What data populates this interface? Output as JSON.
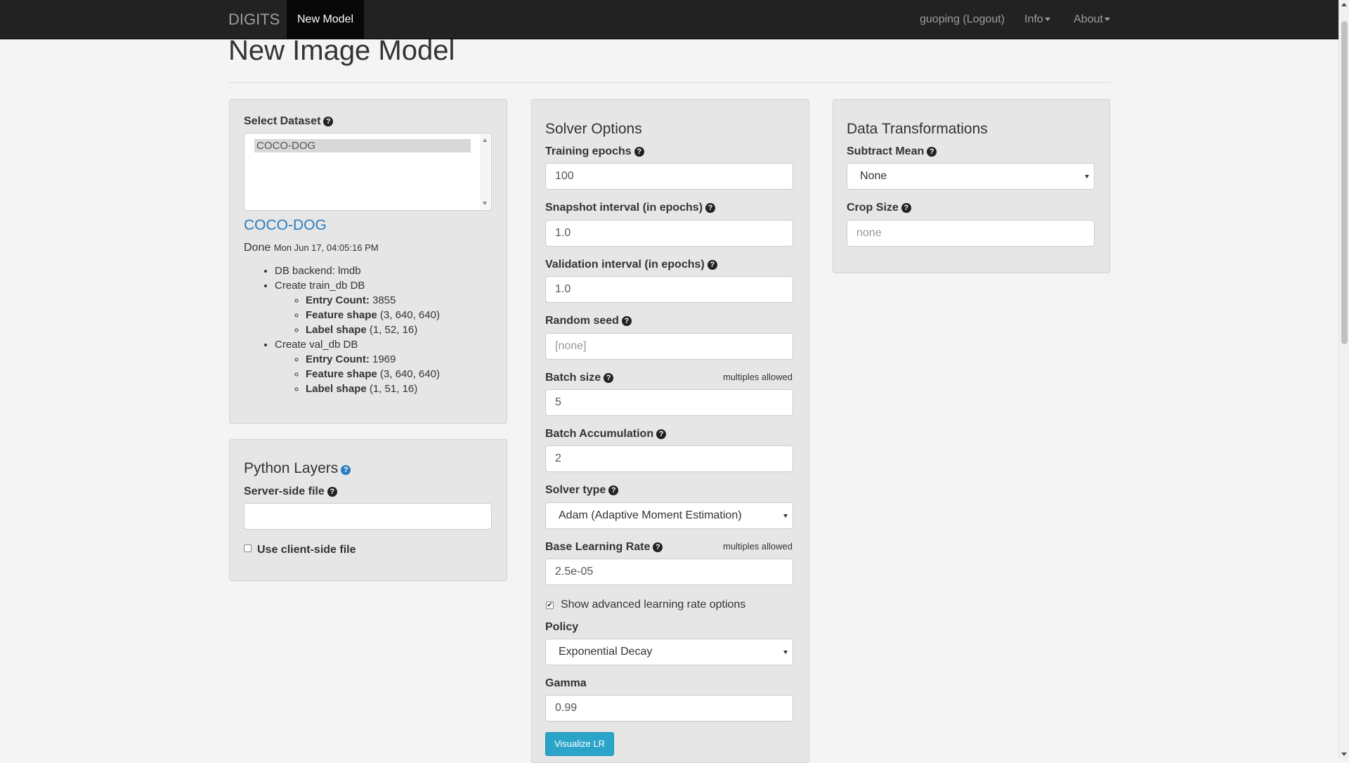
{
  "navbar": {
    "brand": "DIGITS",
    "active_tab": "New Model",
    "user": "guoping (Logout)",
    "info": "Info",
    "about": "About"
  },
  "page": {
    "title": "New Image Model"
  },
  "dataset": {
    "heading": "Select Dataset",
    "options": [
      "COCO-DOG"
    ],
    "selected": "COCO-DOG",
    "link": "COCO-DOG",
    "status": "Done",
    "timestamp": "Mon Jun 17, 04:05:16 PM",
    "details": {
      "backend": "DB backend: lmdb",
      "train": {
        "title": "Create train_db DB",
        "entry_count_label": "Entry Count:",
        "entry_count": "3855",
        "feature_shape_label": "Feature shape",
        "feature_shape": "(3, 640, 640)",
        "label_shape_label": "Label shape",
        "label_shape": "(1, 52, 16)"
      },
      "val": {
        "title": "Create val_db DB",
        "entry_count_label": "Entry Count:",
        "entry_count": "1969",
        "feature_shape_label": "Feature shape",
        "feature_shape": "(3, 640, 640)",
        "label_shape_label": "Label shape",
        "label_shape": "(1, 51, 16)"
      }
    }
  },
  "python_layers": {
    "heading": "Python Layers",
    "server_file_label": "Server-side file",
    "server_file_value": "",
    "client_checkbox_label": "Use client-side file",
    "client_checked": false
  },
  "solver": {
    "heading": "Solver Options",
    "training_epochs_label": "Training epochs",
    "training_epochs": "100",
    "snapshot_label": "Snapshot interval (in epochs)",
    "snapshot": "1.0",
    "validation_label": "Validation interval (in epochs)",
    "validation": "1.0",
    "seed_label": "Random seed",
    "seed_placeholder": "[none]",
    "batch_size_label": "Batch size",
    "batch_size_note": "multiples allowed",
    "batch_size": "5",
    "batch_accum_label": "Batch Accumulation",
    "batch_accum": "2",
    "solver_type_label": "Solver type",
    "solver_type": "Adam (Adaptive Moment Estimation)",
    "lr_label": "Base Learning Rate",
    "lr_note": "multiples allowed",
    "lr": "2.5e-05",
    "advanced_label": "Show advanced learning rate options",
    "advanced_checked": true,
    "policy_label": "Policy",
    "policy": "Exponential Decay",
    "gamma_label": "Gamma",
    "gamma": "0.99",
    "visualize_button": "Visualize LR"
  },
  "transforms": {
    "heading": "Data Transformations",
    "subtract_mean_label": "Subtract Mean",
    "subtract_mean": "None",
    "crop_label": "Crop Size",
    "crop_placeholder": "none"
  },
  "icons": {
    "help": "question-circle-icon",
    "check": "✔",
    "help_color": "#222222",
    "python_help_color": "#2a7ec1"
  }
}
